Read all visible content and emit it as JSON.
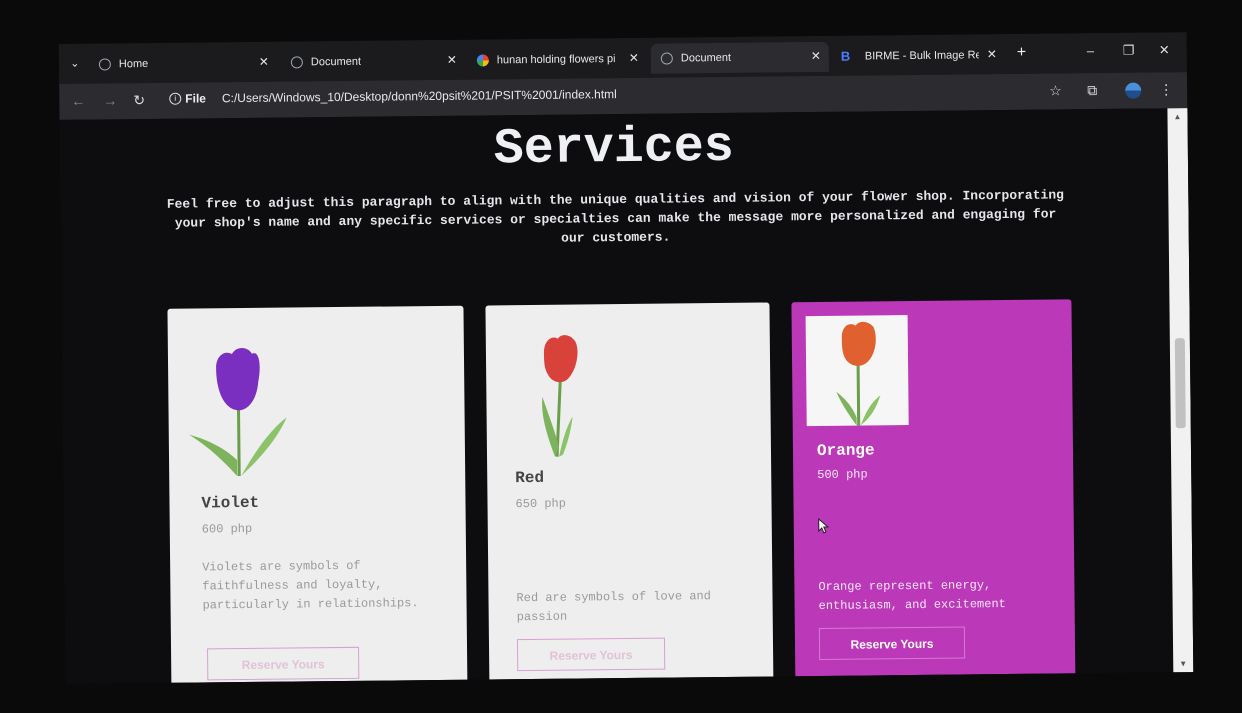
{
  "browser": {
    "tabs": [
      {
        "label": "Home",
        "icon": "globe-icon"
      },
      {
        "label": "Document",
        "icon": "globe-icon"
      },
      {
        "label": "hunan holding flowers pink",
        "icon": "google-icon"
      },
      {
        "label": "Document",
        "icon": "globe-icon",
        "active": true
      },
      {
        "label": "BIRME - Bulk Image Resizin",
        "icon": "birme-icon"
      }
    ],
    "file_chip": "File",
    "url": "C:/Users/Windows_10/Desktop/donn%20psit%201/PSIT%2001/index.html"
  },
  "services": {
    "title": "Services",
    "description": "Feel free to adjust this paragraph to align with the unique qualities and vision of your flower shop. Incorporating your shop's name and any specific services or specialties can make the message more personalized and engaging for our customers."
  },
  "cards": [
    {
      "name": "Violet",
      "price": "600 php",
      "description": "Violets are symbols of faithfulness and loyalty, particularly in relationships.",
      "button": "Reserve Yours",
      "flower_color": "#7b2fc0"
    },
    {
      "name": "Red",
      "price": "650 php",
      "description": "Red are symbols of love and passion",
      "button": "Reserve Yours",
      "flower_color": "#d9423b"
    },
    {
      "name": "Orange",
      "price": "500 php",
      "description": "Orange represent energy, enthusiasm, and excitement",
      "button": "Reserve Yours",
      "flower_color": "#e0612f"
    }
  ],
  "colors": {
    "page_bg": "#0d0d10",
    "card_light": "#eeeeee",
    "card_highlight": "#bb38b8"
  }
}
